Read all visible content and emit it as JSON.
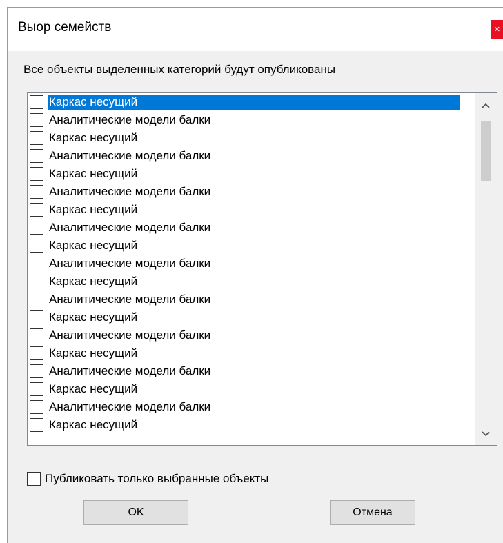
{
  "window": {
    "title": "Выор семейств",
    "close_glyph": "×"
  },
  "description": "Все объекты выделенных категорий будут опубликованы",
  "list": {
    "items": [
      {
        "label": "Каркас несущий",
        "selected": true,
        "checked": false
      },
      {
        "label": "Аналитические модели балки",
        "selected": false,
        "checked": false
      },
      {
        "label": "Каркас несущий",
        "selected": false,
        "checked": false
      },
      {
        "label": "Аналитические модели балки",
        "selected": false,
        "checked": false
      },
      {
        "label": "Каркас несущий",
        "selected": false,
        "checked": false
      },
      {
        "label": "Аналитические модели балки",
        "selected": false,
        "checked": false
      },
      {
        "label": "Каркас несущий",
        "selected": false,
        "checked": false
      },
      {
        "label": "Аналитические модели балки",
        "selected": false,
        "checked": false
      },
      {
        "label": "Каркас несущий",
        "selected": false,
        "checked": false
      },
      {
        "label": "Аналитические модели балки",
        "selected": false,
        "checked": false
      },
      {
        "label": "Каркас несущий",
        "selected": false,
        "checked": false
      },
      {
        "label": "Аналитические модели балки",
        "selected": false,
        "checked": false
      },
      {
        "label": "Каркас несущий",
        "selected": false,
        "checked": false
      },
      {
        "label": "Аналитические модели балки",
        "selected": false,
        "checked": false
      },
      {
        "label": "Каркас несущий",
        "selected": false,
        "checked": false
      },
      {
        "label": "Аналитические модели балки",
        "selected": false,
        "checked": false
      },
      {
        "label": "Каркас несущий",
        "selected": false,
        "checked": false
      },
      {
        "label": "Аналитические модели балки",
        "selected": false,
        "checked": false
      },
      {
        "label": "Каркас несущий",
        "selected": false,
        "checked": false
      }
    ]
  },
  "option": {
    "label": "Публиковать только выбранные объекты",
    "checked": false
  },
  "buttons": {
    "ok": "OK",
    "cancel": "Отмена"
  },
  "colors": {
    "selection": "#0078d7",
    "close": "#e81123",
    "dialog_bg": "#f0f0f0"
  },
  "icons": {
    "scroll_up": "chevron-up-icon",
    "scroll_down": "chevron-down-icon",
    "close": "close-icon"
  }
}
